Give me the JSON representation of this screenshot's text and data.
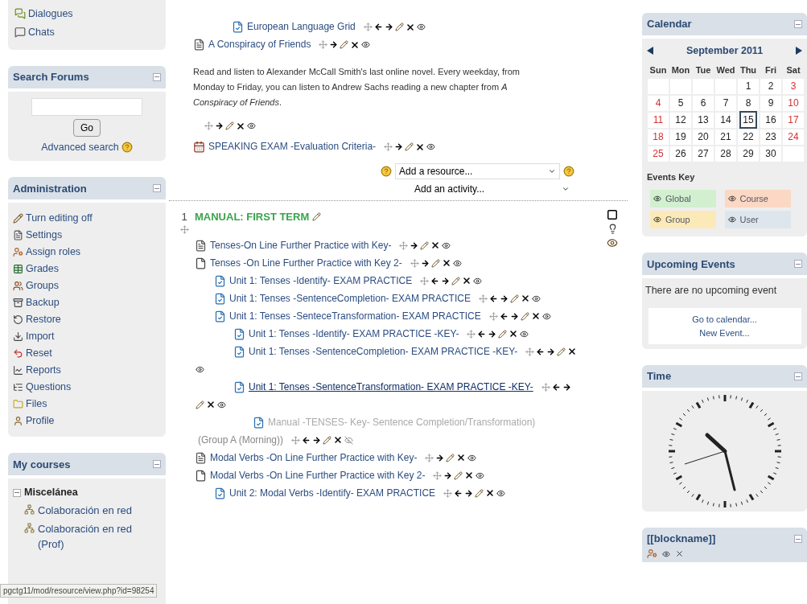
{
  "left_blocks": {
    "top_block": {
      "items": [
        "Dialogues",
        "Chats"
      ]
    },
    "search_forums": {
      "title": "Search Forums",
      "button": "Go",
      "advanced_link": "Advanced search"
    },
    "administration": {
      "title": "Administration",
      "items": [
        "Turn editing off",
        "Settings",
        "Assign roles",
        "Grades",
        "Groups",
        "Backup",
        "Restore",
        "Import",
        "Reset",
        "Reports",
        "Questions",
        "Files",
        "Profile"
      ]
    },
    "my_courses": {
      "title": "My courses",
      "categories": [
        {
          "label": "Miscelánea",
          "expanded": true,
          "courses": [
            "Colaboración en red",
            "Colaboración en red (Prof)"
          ]
        }
      ]
    }
  },
  "course": {
    "top_items": [
      {
        "kind": "quiz",
        "name": "European Language Grid",
        "indented": true,
        "hidden": false,
        "hovered": false
      },
      {
        "kind": "page",
        "name": "A Conspiracy of Friends",
        "indented": false,
        "hidden": false,
        "hovered": false
      },
      {
        "kind": "label",
        "text": "Read and listen to Alexander McCall Smith's last online novel. Every weekday, from Monday to Friday, you can listen to Andrew Sachs reading a new chapter from *A Conspiracy of Friends*.",
        "hidden": false
      },
      {
        "kind": "calendar",
        "name": "SPEAKING EXAM -Evaluation Criteria-",
        "indented": false,
        "hidden": false,
        "hovered": false
      }
    ],
    "add_resource": "Add a resource...",
    "add_activity": "Add an activity...",
    "section": {
      "number": "1",
      "title": "MANUAL: FIRST TERM",
      "items": [
        {
          "kind": "page",
          "name": "Tenses-On Line Further Practice with Key-",
          "hidden": false,
          "hovered": false
        },
        {
          "kind": "file",
          "name": "Tenses -On Line Further Practice with Key 2-",
          "hidden": false,
          "hovered": false,
          "children": [
            {
              "kind": "quiz",
              "name": "Unit 1: Tenses -Identify- EXAM PRACTICE",
              "hidden": false,
              "hovered": false
            },
            {
              "kind": "quiz",
              "name": "Unit 1: Tenses -SentenceCompletion- EXAM PRACTICE",
              "hidden": false,
              "hovered": false
            },
            {
              "kind": "quiz",
              "name": "Unit 1: Tenses -SenteceTransformation- EXAM PRACTICE",
              "hidden": false,
              "hovered": false,
              "children": [
                {
                  "kind": "quiz",
                  "name": "Unit 1: Tenses -Identify- EXAM PRACTICE -KEY-",
                  "hidden": false,
                  "hovered": false
                },
                {
                  "kind": "quiz",
                  "name": "Unit 1: Tenses -SentenceCompletion- EXAM PRACTICE -KEY-",
                  "hidden": false,
                  "hovered": false
                },
                {
                  "kind": "quiz",
                  "name": "Unit 1: Tenses -SentenceTransformation- EXAM PRACTICE -KEY-",
                  "hidden": false,
                  "hovered": true,
                  "children": [
                    {
                      "kind": "quiz",
                      "name": "Manual -TENSES- Key- Sentence Completion/Transformation)",
                      "group": "(Group A (Morning))",
                      "hidden": true,
                      "hovered": false
                    }
                  ]
                }
              ]
            }
          ]
        },
        {
          "kind": "page",
          "name": "Modal Verbs -On Line Further Practice with Key-",
          "hidden": false,
          "hovered": false
        },
        {
          "kind": "file",
          "name": "Modal Verbs -On Line Further Practice with Key 2-",
          "hidden": false,
          "hovered": false,
          "children": [
            {
              "kind": "quiz",
              "name": "Unit 2: Modal Verbs -Identify- EXAM PRACTICE",
              "hidden": false,
              "hovered": false
            }
          ]
        }
      ]
    }
  },
  "calendar": {
    "title": "Calendar",
    "month": "September 2011",
    "weekdays": [
      "Sun",
      "Mon",
      "Tue",
      "Wed",
      "Thu",
      "Fri",
      "Sat"
    ],
    "weeks": [
      [
        {
          "day": "1",
          "today": false
        },
        {
          "day": "2",
          "today": false
        },
        {
          "day": "3",
          "today": false
        }
      ],
      [
        {
          "day": "4",
          "today": false
        },
        {
          "day": "5",
          "today": false
        },
        {
          "day": "6",
          "today": false
        },
        {
          "day": "7",
          "today": false
        },
        {
          "day": "8",
          "today": false
        },
        {
          "day": "9",
          "today": false
        },
        {
          "day": "10",
          "today": false
        }
      ],
      [
        {
          "day": "11",
          "today": false
        },
        {
          "day": "12",
          "today": false
        },
        {
          "day": "13",
          "today": false
        },
        {
          "day": "14",
          "today": false
        },
        {
          "day": "15",
          "today": true
        },
        {
          "day": "16",
          "today": false
        },
        {
          "day": "17",
          "today": false
        }
      ],
      [
        {
          "day": "18",
          "today": false
        },
        {
          "day": "19",
          "today": false
        },
        {
          "day": "20",
          "today": false
        },
        {
          "day": "21",
          "today": false
        },
        {
          "day": "22",
          "today": false
        },
        {
          "day": "23",
          "today": false
        },
        {
          "day": "24",
          "today": false
        }
      ],
      [
        {
          "day": "25",
          "today": false
        },
        {
          "day": "26",
          "today": false
        },
        {
          "day": "27",
          "today": false
        },
        {
          "day": "28",
          "today": false
        },
        {
          "day": "29",
          "today": false
        },
        {
          "day": "30",
          "today": false
        }
      ]
    ],
    "events_key_title": "Events Key",
    "events_key": [
      {
        "label": "Global",
        "color": "#d2f0cf"
      },
      {
        "label": "Course",
        "color": "#fbd8c4"
      },
      {
        "label": "Group",
        "color": "#fbeab8"
      },
      {
        "label": "User",
        "color": "#dde6ec"
      }
    ]
  },
  "upcoming_events": {
    "title": "Upcoming Events",
    "message": "There are no upcoming event",
    "links": [
      "Go to calendar...",
      "New Event..."
    ]
  },
  "time_block": {
    "title": "Time"
  },
  "blockname_block": {
    "title": "[[blockname]]"
  },
  "status_url": "pgctg11/mod/resource/view.php?id=98254"
}
